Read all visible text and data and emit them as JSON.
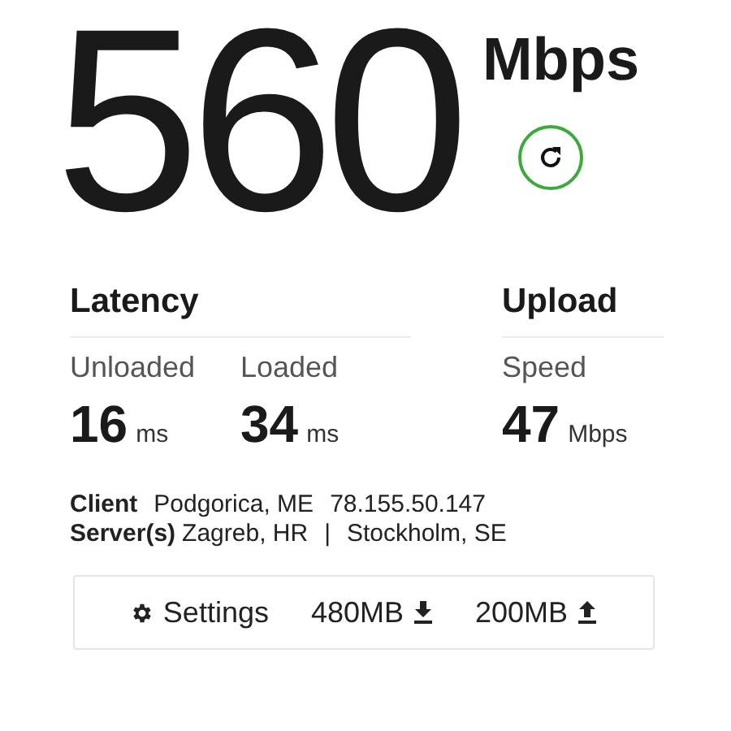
{
  "speed": {
    "value": "560",
    "unit": "Mbps"
  },
  "groups": [
    {
      "title": "Latency",
      "metrics": [
        {
          "label": "Unloaded",
          "value": "16",
          "unit": "ms"
        },
        {
          "label": "Loaded",
          "value": "34",
          "unit": "ms"
        }
      ]
    },
    {
      "title": "Upload",
      "metrics": [
        {
          "label": "Speed",
          "value": "47",
          "unit": "Mbps"
        }
      ]
    }
  ],
  "client": {
    "label": "Client",
    "location": "Podgorica, ME",
    "ip": "78.155.50.147"
  },
  "servers": {
    "label": "Server(s)",
    "locations": [
      "Zagreb, HR",
      "Stockholm, SE"
    ],
    "separator": "|"
  },
  "footer": [
    {
      "kind": "settings",
      "label": "Settings"
    },
    {
      "kind": "download",
      "label": "480MB"
    },
    {
      "kind": "upload",
      "label": "200MB"
    }
  ]
}
